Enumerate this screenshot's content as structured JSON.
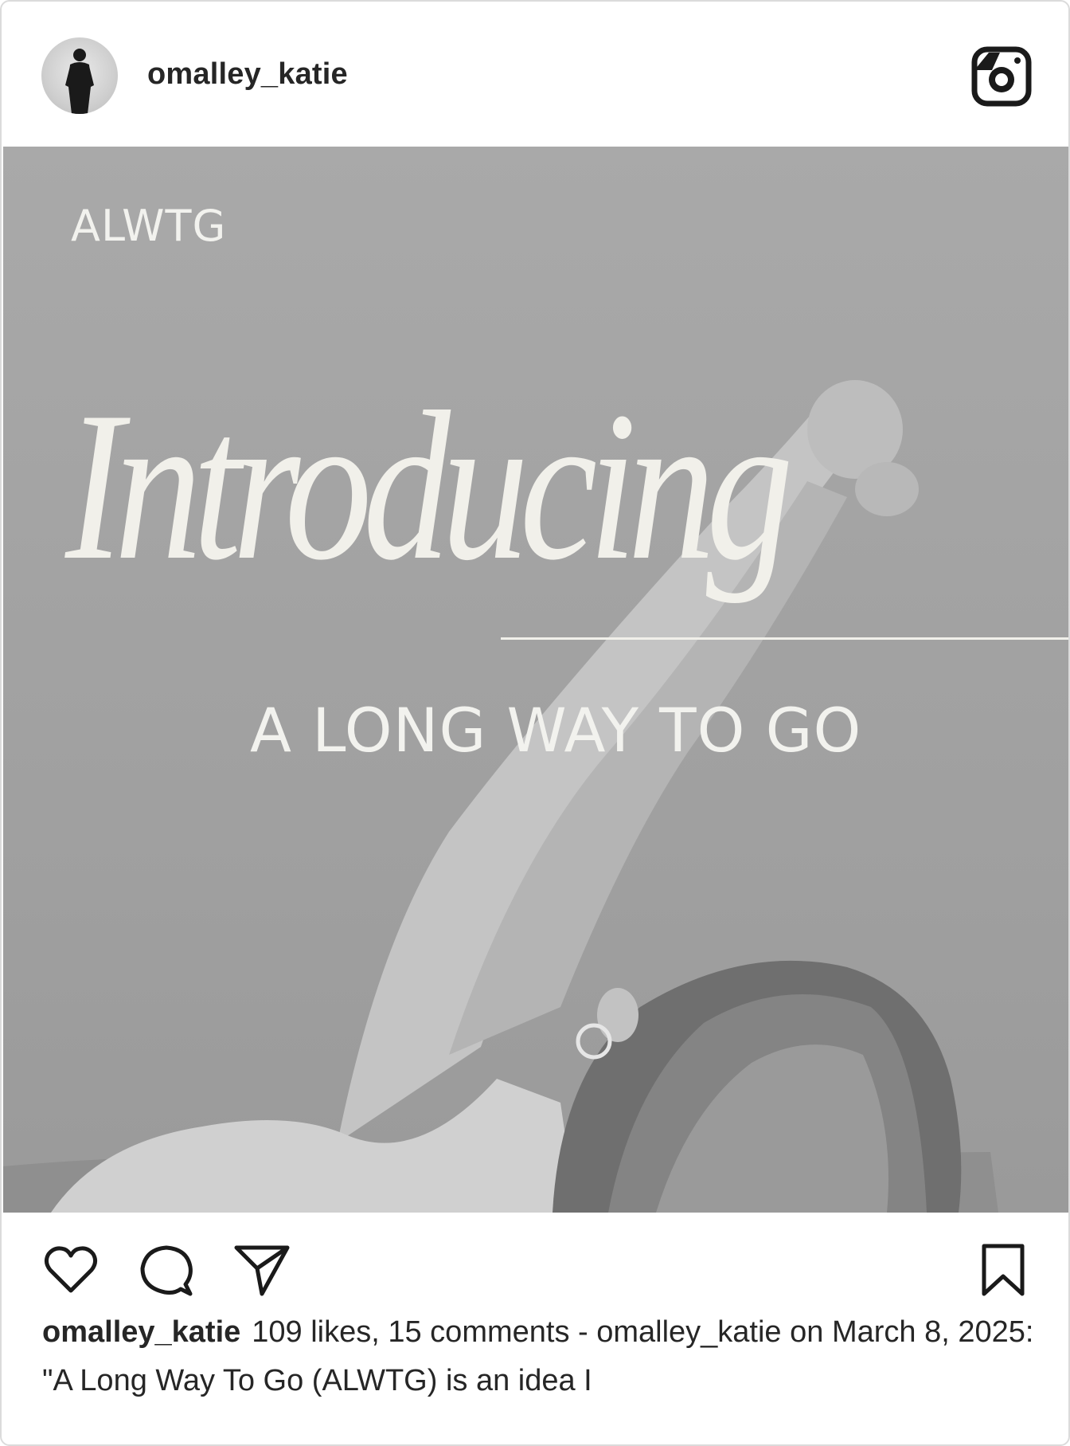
{
  "post": {
    "username": "omalley_katie",
    "overlay": {
      "small_text": "ALWTG",
      "headline": "Introducing",
      "subline": "A LONG WAY TO GO"
    },
    "caption": {
      "username": "omalley_katie",
      "text": "109 likes, 15 comments - omalley_katie on March 8, 2025: \"A Long Way To Go (ALWTG) is an idea I"
    }
  },
  "icons": {
    "brand": "instagram-icon",
    "like": "heart-icon",
    "comment": "comment-icon",
    "share": "send-icon",
    "save": "bookmark-icon"
  },
  "colors": {
    "text": "#262626",
    "border": "#dbdbdb",
    "photo_bg": "#a3a3a3",
    "overlay_text": "#f1f0ea"
  }
}
